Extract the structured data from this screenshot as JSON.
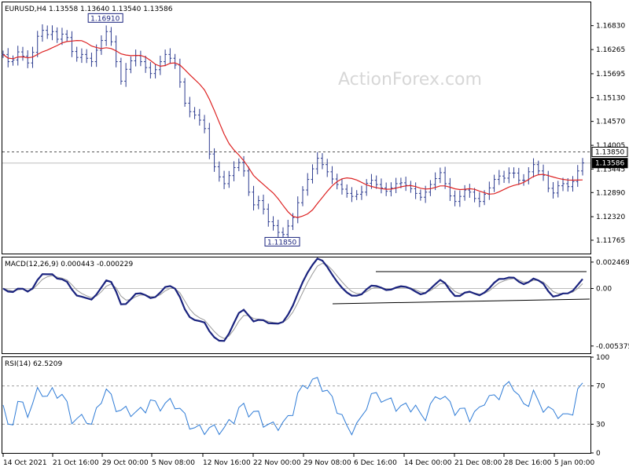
{
  "chart_data": [
    {
      "type": "ohlc",
      "title": "EURUSD,H4  1.13558 1.13640 1.13540 1.13586",
      "watermark": "ActionForex.com",
      "ylim": [
        1.1145,
        1.1738
      ],
      "y_ticks": [
        "1.16830",
        "1.16265",
        "1.15695",
        "1.15130",
        "1.14570",
        "1.14005",
        "1.13445",
        "1.12890",
        "1.12320",
        "1.11765"
      ],
      "y_tick_values": [
        1.1683,
        1.16265,
        1.15695,
        1.1513,
        1.1457,
        1.14005,
        1.13445,
        1.1289,
        1.1232,
        1.11765
      ],
      "levels": [
        {
          "label": "1.13850",
          "value": 1.1385,
          "style": "dashed"
        },
        {
          "label": "1.13586",
          "value": 1.13586,
          "style": "solid-grey",
          "highlight": true
        }
      ],
      "annotations": [
        {
          "label": "1.16910",
          "value": 1.1691,
          "x_index": 21
        },
        {
          "label": "1.11850",
          "value": 1.1185,
          "x_index": 57
        }
      ],
      "moving_average_color": "#dd2222",
      "bar_color": "#2c3b8f",
      "closes": [
        1.1615,
        1.1598,
        1.1602,
        1.1621,
        1.1611,
        1.1595,
        1.162,
        1.1658,
        1.1672,
        1.1662,
        1.1669,
        1.1651,
        1.1663,
        1.1655,
        1.1622,
        1.1608,
        1.1615,
        1.1606,
        1.1598,
        1.1625,
        1.1648,
        1.1669,
        1.1645,
        1.1598,
        1.1552,
        1.158,
        1.16,
        1.1612,
        1.1598,
        1.1584,
        1.157,
        1.1579,
        1.1598,
        1.1615,
        1.1606,
        1.159,
        1.155,
        1.15,
        1.148,
        1.1472,
        1.146,
        1.144,
        1.138,
        1.135,
        1.1326,
        1.131,
        1.1329,
        1.1348,
        1.136,
        1.134,
        1.129,
        1.126,
        1.127,
        1.125,
        1.122,
        1.1211,
        1.1195,
        1.119,
        1.121,
        1.123,
        1.1265,
        1.1295,
        1.132,
        1.1345,
        1.137,
        1.1355,
        1.1338,
        1.1321,
        1.1308,
        1.1297,
        1.1287,
        1.128,
        1.1285,
        1.129,
        1.1311,
        1.1318,
        1.1308,
        1.13,
        1.1292,
        1.13,
        1.131,
        1.1312,
        1.1306,
        1.1298,
        1.1287,
        1.1278,
        1.129,
        1.1308,
        1.1322,
        1.1336,
        1.131,
        1.1281,
        1.1268,
        1.128,
        1.1295,
        1.129,
        1.1275,
        1.1268,
        1.1285,
        1.13,
        1.132,
        1.1328,
        1.1323,
        1.1335,
        1.1335,
        1.1318,
        1.1318,
        1.1338,
        1.1355,
        1.134,
        1.133,
        1.1299,
        1.1288,
        1.1305,
        1.131,
        1.1303,
        1.1315,
        1.134,
        1.1359
      ],
      "x_labels": [
        "14 Oct 2021",
        "21 Oct 16:00",
        "29 Oct 00:00",
        "5 Nov 08:00",
        "12 Nov 16:00",
        "22 Nov 00:00",
        "29 Nov 08:00",
        "6 Dec 16:00",
        "14 Dec 00:00",
        "21 Dec 08:00",
        "28 Dec 16:00",
        "5 Jan 00:00"
      ]
    },
    {
      "type": "line",
      "title": "MACD(12,26,9) 0.000443 -0.000229",
      "ylim": [
        -0.00605,
        0.0029
      ],
      "y_ticks": [
        "0.002469",
        "0.00",
        "-0.005375"
      ],
      "y_tick_values": [
        0.002469,
        0.0,
        -0.005375
      ],
      "series_color": "#1a237e",
      "signal_color": "#999999"
    },
    {
      "type": "line",
      "title": "RSI(14) 62.5209",
      "ylim": [
        0,
        100
      ],
      "y_ticks": [
        "100",
        "70",
        "30",
        "0"
      ],
      "y_tick_values": [
        100,
        70,
        30,
        0
      ],
      "levels": [
        70,
        30
      ],
      "series_color": "#2e7bd6"
    }
  ]
}
